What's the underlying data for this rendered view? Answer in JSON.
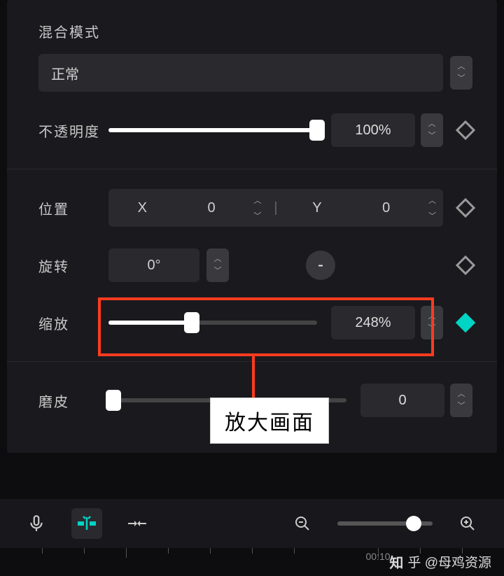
{
  "blend": {
    "label": "混合模式",
    "value": "正常"
  },
  "opacity": {
    "label": "不透明度",
    "value": "100%",
    "percent": 100
  },
  "position": {
    "label": "位置",
    "x_label": "X",
    "x_value": "0",
    "y_label": "Y",
    "y_value": "0"
  },
  "rotation": {
    "label": "旋转",
    "value": "0°",
    "dash": "-"
  },
  "scale": {
    "label": "缩放",
    "value": "248%",
    "percent": 40
  },
  "smoothing": {
    "label": "磨皮",
    "value": "0",
    "percent": 2
  },
  "annotation": {
    "text": "放大画面"
  },
  "timeline": {
    "timestamp": "00:10"
  },
  "watermark": {
    "icon": "知",
    "text": "乎 @母鸡资源"
  },
  "colors": {
    "accent": "#00d4c4",
    "highlight": "#ff3b1f"
  }
}
